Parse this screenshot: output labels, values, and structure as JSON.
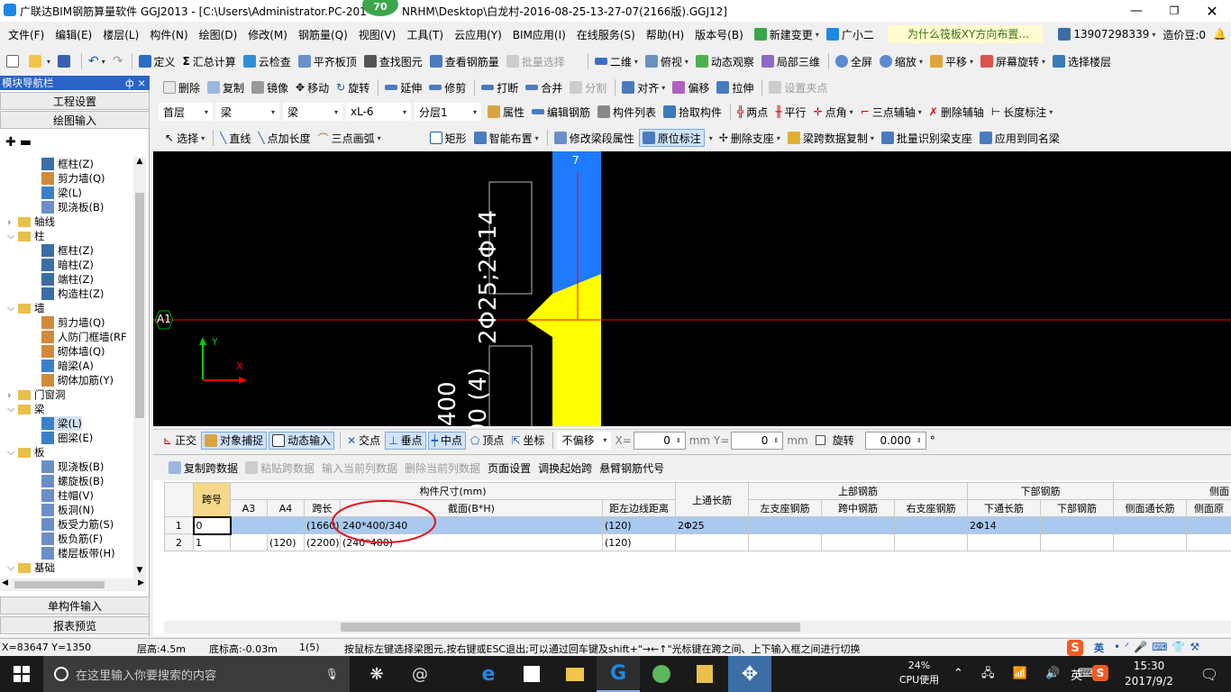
{
  "title_bar": {
    "title": "广联达BIM钢筋算量软件 GGJ2013 - [C:\\Users\\Administrator.PC-201",
    "title_tail": "NRHM\\Desktop\\白龙村-2016-08-25-13-27-07(2166版).GGJ12]",
    "badge": "70"
  },
  "menu": {
    "items": [
      "文件(F)",
      "编辑(E)",
      "楼层(L)",
      "构件(N)",
      "绘图(D)",
      "修改(M)",
      "钢筋量(Q)",
      "视图(V)",
      "工具(T)",
      "云应用(Y)",
      "BIM应用(I)",
      "在线服务(S)",
      "帮助(H)",
      "版本号(B)"
    ],
    "new_change": "新建变更",
    "guang": "广小二",
    "question": "为什么筏板XY方向布置...",
    "phone": "13907298339",
    "price": "造价豆:0"
  },
  "toolbar1": [
    "定义",
    "汇总计算",
    "云检查",
    "平齐板顶",
    "查找图元",
    "查看钢筋量",
    "批量选择",
    "二维",
    "俯视",
    "动态观察",
    "局部三维",
    "全屏",
    "缩放",
    "平移",
    "屏幕旋转",
    "选择楼层"
  ],
  "toolbar2": [
    "删除",
    "复制",
    "镜像",
    "移动",
    "旋转",
    "延伸",
    "修剪",
    "打断",
    "合并",
    "分割",
    "对齐",
    "偏移",
    "拉伸",
    "设置夹点"
  ],
  "toolbar3": {
    "floor": "首层",
    "type1": "梁",
    "type2": "梁",
    "name": "xL-6",
    "layer": "分层1",
    "items": [
      "属性",
      "编辑钢筋",
      "构件列表",
      "拾取构件",
      "两点",
      "平行",
      "点角",
      "三点辅轴",
      "删除辅轴",
      "长度标注"
    ]
  },
  "toolbar4": [
    "选择",
    "直线",
    "点加长度",
    "三点画弧",
    "矩形",
    "智能布置",
    "修改梁段属性",
    "原位标注",
    "删除支座",
    "梁跨数据复制",
    "批量识别梁支座",
    "应用到同名梁"
  ],
  "left_panel": {
    "title": "模块导航栏",
    "pin": "ф ×",
    "project_settings": "工程设置",
    "drawing_input": "绘图输入",
    "tree": [
      {
        "level": 2,
        "label": "框柱(Z)",
        "icon": "col"
      },
      {
        "level": 2,
        "label": "剪力墙(Q)",
        "icon": "wall"
      },
      {
        "level": 2,
        "label": "梁(L)",
        "icon": "beam"
      },
      {
        "level": 2,
        "label": "现浇板(B)",
        "icon": "slab"
      },
      {
        "level": 1,
        "label": "轴线",
        "icon": "folder",
        "toggle": "closed"
      },
      {
        "level": 1,
        "label": "柱",
        "icon": "folder",
        "toggle": "open"
      },
      {
        "level": 2,
        "label": "框柱(Z)",
        "icon": "col"
      },
      {
        "level": 2,
        "label": "暗柱(Z)",
        "icon": "col"
      },
      {
        "level": 2,
        "label": "端柱(Z)",
        "icon": "col"
      },
      {
        "level": 2,
        "label": "构造柱(Z)",
        "icon": "col"
      },
      {
        "level": 1,
        "label": "墙",
        "icon": "folder",
        "toggle": "open"
      },
      {
        "level": 2,
        "label": "剪力墙(Q)",
        "icon": "wall"
      },
      {
        "level": 2,
        "label": "人防门框墙(RF",
        "icon": "wall"
      },
      {
        "level": 2,
        "label": "砌体墙(Q)",
        "icon": "wall"
      },
      {
        "level": 2,
        "label": "暗梁(A)",
        "icon": "beam"
      },
      {
        "level": 2,
        "label": "砌体加筋(Y)",
        "icon": "wall"
      },
      {
        "level": 1,
        "label": "门窗洞",
        "icon": "folder",
        "toggle": "closed"
      },
      {
        "level": 1,
        "label": "梁",
        "icon": "folder",
        "toggle": "open"
      },
      {
        "level": 2,
        "label": "梁(L)",
        "icon": "beam",
        "selected": true
      },
      {
        "level": 2,
        "label": "圈梁(E)",
        "icon": "beam"
      },
      {
        "level": 1,
        "label": "板",
        "icon": "folder",
        "toggle": "open"
      },
      {
        "level": 2,
        "label": "现浇板(B)",
        "icon": "slab"
      },
      {
        "level": 2,
        "label": "螺旋板(B)",
        "icon": "slab"
      },
      {
        "level": 2,
        "label": "柱帽(V)",
        "icon": "slab"
      },
      {
        "level": 2,
        "label": "板洞(N)",
        "icon": "slab"
      },
      {
        "level": 2,
        "label": "板受力筋(S)",
        "icon": "slab"
      },
      {
        "level": 2,
        "label": "板负筋(F)",
        "icon": "slab"
      },
      {
        "level": 2,
        "label": "楼层板带(H)",
        "icon": "slab"
      },
      {
        "level": 1,
        "label": "基础",
        "icon": "folder",
        "toggle": "open"
      }
    ],
    "single_input": "单构件输入",
    "report_preview": "报表预览"
  },
  "canvas": {
    "axis_top": "7",
    "axis_left": "A1",
    "text_vertical_1": "2Φ25;2Φ14",
    "text_vertical_2": "00 (4)",
    "text_vertical_3": "*400",
    "ucs_y": "Y",
    "ucs_x": "X"
  },
  "snap_bar": {
    "items": [
      "正交",
      "对象捕捉",
      "动态输入",
      "交点",
      "垂点",
      "中点",
      "顶点",
      "坐标"
    ],
    "offset": "不偏移",
    "x_label": "X=",
    "x_value": "0",
    "y_label": "mm Y=",
    "y_value": "0",
    "mm": "mm",
    "rotate_label": "旋转",
    "rotate_value": "0.000",
    "deg": "°"
  },
  "table_toolbar": [
    "复制跨数据",
    "粘贴跨数据",
    "输入当前列数据",
    "删除当前列数据",
    "页面设置",
    "调换起始跨",
    "悬臂钢筋代号"
  ],
  "table": {
    "group_size": "构件尺寸(mm)",
    "group_top": "上部钢筋",
    "group_bottom": "下部钢筋",
    "group_side": "侧面",
    "headers": [
      "跨号",
      "A3",
      "A4",
      "跨长",
      "截面(B*H)",
      "距左边线距离",
      "上通长筋",
      "左支座钢筋",
      "跨中钢筋",
      "右支座钢筋",
      "下通长筋",
      "下部钢筋",
      "侧面通长筋",
      "侧面原"
    ],
    "rows": [
      {
        "n": "1",
        "span": "0",
        "a3": "",
        "a4": "",
        "len": "(1660)",
        "section": "240*400/340",
        "dist": "(120)",
        "top": "2Φ25",
        "left": "",
        "mid": "",
        "right": "",
        "bottom": "2Φ14",
        "lower": "",
        "side": "",
        "side2": ""
      },
      {
        "n": "2",
        "span": "1",
        "a3": "",
        "a4": "(120)",
        "len": "(2200)",
        "section": "(240*400)",
        "dist": "(120)",
        "top": "",
        "left": "",
        "mid": "",
        "right": "",
        "bottom": "",
        "lower": "",
        "side": "",
        "side2": ""
      }
    ]
  },
  "status_bar": {
    "coords": "X=83647 Y=1350",
    "floor_height": "层高:4.5m",
    "base_height": "底标高:-0.03m",
    "count": "1(5)",
    "hint": "按鼠标左键选择梁图元,按右键或ESC退出;可以通过回车键及shift+\"→←↑\"光标键在跨之间、上下输入框之间进行切换",
    "ime": "英"
  },
  "taskbar": {
    "search_placeholder": "在这里输入你要搜索的内容",
    "cpu_percent": "24%",
    "cpu_label": "CPU使用",
    "ime": "英",
    "time": "15:30",
    "date": "2017/9/2"
  },
  "colors": {
    "canvas_bg": "#000000",
    "beam_blue": "#1e7bff",
    "column_yellow": "#ffff00",
    "axis_red": "#ff0000",
    "row_select": "#a9c9ef",
    "annotation_red": "#e0141e"
  }
}
